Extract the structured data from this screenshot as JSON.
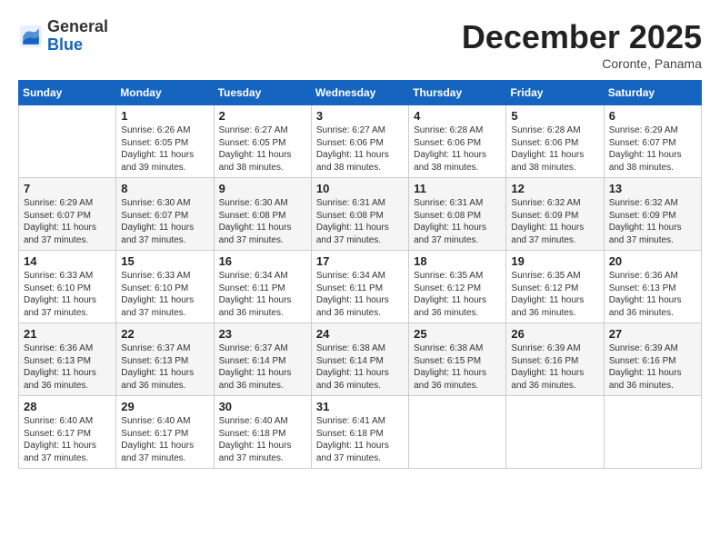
{
  "header": {
    "logo_line1": "General",
    "logo_line2": "Blue",
    "month": "December 2025",
    "location": "Coronte, Panama"
  },
  "days_of_week": [
    "Sunday",
    "Monday",
    "Tuesday",
    "Wednesday",
    "Thursday",
    "Friday",
    "Saturday"
  ],
  "weeks": [
    [
      {
        "num": "",
        "sunrise": "",
        "sunset": "",
        "daylight": ""
      },
      {
        "num": "1",
        "sunrise": "Sunrise: 6:26 AM",
        "sunset": "Sunset: 6:05 PM",
        "daylight": "Daylight: 11 hours and 39 minutes."
      },
      {
        "num": "2",
        "sunrise": "Sunrise: 6:27 AM",
        "sunset": "Sunset: 6:05 PM",
        "daylight": "Daylight: 11 hours and 38 minutes."
      },
      {
        "num": "3",
        "sunrise": "Sunrise: 6:27 AM",
        "sunset": "Sunset: 6:06 PM",
        "daylight": "Daylight: 11 hours and 38 minutes."
      },
      {
        "num": "4",
        "sunrise": "Sunrise: 6:28 AM",
        "sunset": "Sunset: 6:06 PM",
        "daylight": "Daylight: 11 hours and 38 minutes."
      },
      {
        "num": "5",
        "sunrise": "Sunrise: 6:28 AM",
        "sunset": "Sunset: 6:06 PM",
        "daylight": "Daylight: 11 hours and 38 minutes."
      },
      {
        "num": "6",
        "sunrise": "Sunrise: 6:29 AM",
        "sunset": "Sunset: 6:07 PM",
        "daylight": "Daylight: 11 hours and 38 minutes."
      }
    ],
    [
      {
        "num": "7",
        "sunrise": "Sunrise: 6:29 AM",
        "sunset": "Sunset: 6:07 PM",
        "daylight": "Daylight: 11 hours and 37 minutes."
      },
      {
        "num": "8",
        "sunrise": "Sunrise: 6:30 AM",
        "sunset": "Sunset: 6:07 PM",
        "daylight": "Daylight: 11 hours and 37 minutes."
      },
      {
        "num": "9",
        "sunrise": "Sunrise: 6:30 AM",
        "sunset": "Sunset: 6:08 PM",
        "daylight": "Daylight: 11 hours and 37 minutes."
      },
      {
        "num": "10",
        "sunrise": "Sunrise: 6:31 AM",
        "sunset": "Sunset: 6:08 PM",
        "daylight": "Daylight: 11 hours and 37 minutes."
      },
      {
        "num": "11",
        "sunrise": "Sunrise: 6:31 AM",
        "sunset": "Sunset: 6:08 PM",
        "daylight": "Daylight: 11 hours and 37 minutes."
      },
      {
        "num": "12",
        "sunrise": "Sunrise: 6:32 AM",
        "sunset": "Sunset: 6:09 PM",
        "daylight": "Daylight: 11 hours and 37 minutes."
      },
      {
        "num": "13",
        "sunrise": "Sunrise: 6:32 AM",
        "sunset": "Sunset: 6:09 PM",
        "daylight": "Daylight: 11 hours and 37 minutes."
      }
    ],
    [
      {
        "num": "14",
        "sunrise": "Sunrise: 6:33 AM",
        "sunset": "Sunset: 6:10 PM",
        "daylight": "Daylight: 11 hours and 37 minutes."
      },
      {
        "num": "15",
        "sunrise": "Sunrise: 6:33 AM",
        "sunset": "Sunset: 6:10 PM",
        "daylight": "Daylight: 11 hours and 37 minutes."
      },
      {
        "num": "16",
        "sunrise": "Sunrise: 6:34 AM",
        "sunset": "Sunset: 6:11 PM",
        "daylight": "Daylight: 11 hours and 36 minutes."
      },
      {
        "num": "17",
        "sunrise": "Sunrise: 6:34 AM",
        "sunset": "Sunset: 6:11 PM",
        "daylight": "Daylight: 11 hours and 36 minutes."
      },
      {
        "num": "18",
        "sunrise": "Sunrise: 6:35 AM",
        "sunset": "Sunset: 6:12 PM",
        "daylight": "Daylight: 11 hours and 36 minutes."
      },
      {
        "num": "19",
        "sunrise": "Sunrise: 6:35 AM",
        "sunset": "Sunset: 6:12 PM",
        "daylight": "Daylight: 11 hours and 36 minutes."
      },
      {
        "num": "20",
        "sunrise": "Sunrise: 6:36 AM",
        "sunset": "Sunset: 6:13 PM",
        "daylight": "Daylight: 11 hours and 36 minutes."
      }
    ],
    [
      {
        "num": "21",
        "sunrise": "Sunrise: 6:36 AM",
        "sunset": "Sunset: 6:13 PM",
        "daylight": "Daylight: 11 hours and 36 minutes."
      },
      {
        "num": "22",
        "sunrise": "Sunrise: 6:37 AM",
        "sunset": "Sunset: 6:13 PM",
        "daylight": "Daylight: 11 hours and 36 minutes."
      },
      {
        "num": "23",
        "sunrise": "Sunrise: 6:37 AM",
        "sunset": "Sunset: 6:14 PM",
        "daylight": "Daylight: 11 hours and 36 minutes."
      },
      {
        "num": "24",
        "sunrise": "Sunrise: 6:38 AM",
        "sunset": "Sunset: 6:14 PM",
        "daylight": "Daylight: 11 hours and 36 minutes."
      },
      {
        "num": "25",
        "sunrise": "Sunrise: 6:38 AM",
        "sunset": "Sunset: 6:15 PM",
        "daylight": "Daylight: 11 hours and 36 minutes."
      },
      {
        "num": "26",
        "sunrise": "Sunrise: 6:39 AM",
        "sunset": "Sunset: 6:16 PM",
        "daylight": "Daylight: 11 hours and 36 minutes."
      },
      {
        "num": "27",
        "sunrise": "Sunrise: 6:39 AM",
        "sunset": "Sunset: 6:16 PM",
        "daylight": "Daylight: 11 hours and 36 minutes."
      }
    ],
    [
      {
        "num": "28",
        "sunrise": "Sunrise: 6:40 AM",
        "sunset": "Sunset: 6:17 PM",
        "daylight": "Daylight: 11 hours and 37 minutes."
      },
      {
        "num": "29",
        "sunrise": "Sunrise: 6:40 AM",
        "sunset": "Sunset: 6:17 PM",
        "daylight": "Daylight: 11 hours and 37 minutes."
      },
      {
        "num": "30",
        "sunrise": "Sunrise: 6:40 AM",
        "sunset": "Sunset: 6:18 PM",
        "daylight": "Daylight: 11 hours and 37 minutes."
      },
      {
        "num": "31",
        "sunrise": "Sunrise: 6:41 AM",
        "sunset": "Sunset: 6:18 PM",
        "daylight": "Daylight: 11 hours and 37 minutes."
      },
      {
        "num": "",
        "sunrise": "",
        "sunset": "",
        "daylight": ""
      },
      {
        "num": "",
        "sunrise": "",
        "sunset": "",
        "daylight": ""
      },
      {
        "num": "",
        "sunrise": "",
        "sunset": "",
        "daylight": ""
      }
    ]
  ]
}
